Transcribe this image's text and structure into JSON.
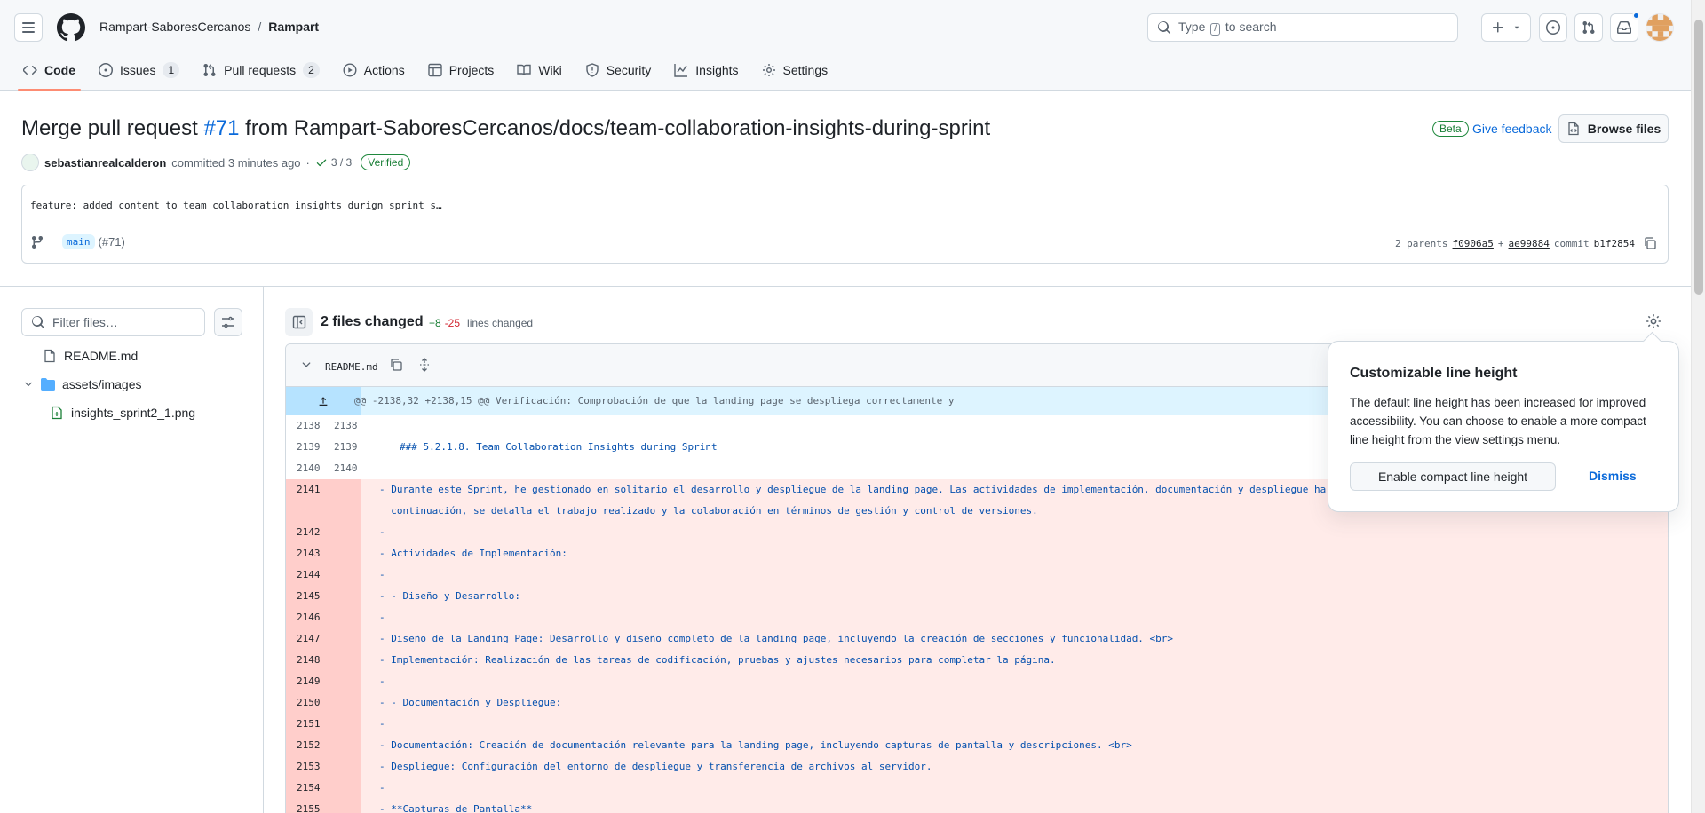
{
  "header": {
    "owner": "Rampart-SaboresCercanos",
    "separator": "/",
    "repo": "Rampart",
    "search_prefix": "Type",
    "search_key": "/",
    "search_suffix": "to search"
  },
  "repo_nav": [
    {
      "label": "Code",
      "icon": "code-icon",
      "selected": true
    },
    {
      "label": "Issues",
      "icon": "issue-icon",
      "count": "1"
    },
    {
      "label": "Pull requests",
      "icon": "pull-request-icon",
      "count": "2"
    },
    {
      "label": "Actions",
      "icon": "play-icon"
    },
    {
      "label": "Projects",
      "icon": "table-icon"
    },
    {
      "label": "Wiki",
      "icon": "book-icon"
    },
    {
      "label": "Security",
      "icon": "shield-icon"
    },
    {
      "label": "Insights",
      "icon": "graph-icon"
    },
    {
      "label": "Settings",
      "icon": "gear-icon"
    }
  ],
  "commit": {
    "title_prefix": "Merge pull request",
    "pr_number": "#71",
    "title_suffix": "from Rampart-SaboresCercanos/docs/team-collaboration-insights-during-sprint",
    "beta_label": "Beta",
    "feedback_label": "Give feedback",
    "browse_label": "Browse files",
    "author": "sebastianrealcalderon",
    "committed_text": "committed 3 minutes ago",
    "dot": "·",
    "checks": "3 / 3",
    "verified": "Verified",
    "message": "feature: added content to team collaboration insights durign sprint s…",
    "branch": "main",
    "branch_pr": "(#71)",
    "parents_label": "2 parents",
    "parent1": "f0906a5",
    "plus": "+",
    "parent2": "ae99884",
    "commit_label": "commit",
    "commit_sha": "b1f2854"
  },
  "sidebar": {
    "filter_placeholder": "Filter files…",
    "files": [
      {
        "name": "README.md",
        "type": "file"
      },
      {
        "name": "assets/images",
        "type": "folder"
      },
      {
        "name": "insights_sprint2_1.png",
        "type": "added-file"
      }
    ]
  },
  "diff": {
    "files_changed": "2 files changed",
    "additions": "+8",
    "deletions": "-25",
    "lines_changed": "lines changed",
    "file_name": "README.md",
    "hunk": "@@ -2138,32 +2138,15 @@ Verificación: Comprobación de que la landing page se despliega correctamente y",
    "rows": [
      {
        "kind": "ctx",
        "old": "2138",
        "new": "2138",
        "text": ""
      },
      {
        "kind": "ctx",
        "old": "2139",
        "new": "2139",
        "text": "### 5.2.1.8. Team Collaboration Insights during Sprint"
      },
      {
        "kind": "ctx",
        "old": "2140",
        "new": "2140",
        "text": ""
      },
      {
        "kind": "del-tall",
        "old": "2141",
        "new": "",
        "text": "- Durante este Sprint, he gestionado en solitario el desarrollo y despliegue de la landing page. Las actividades de implementación, documentación y despliegue ha",
        "text2": "  continuación, se detalla el trabajo realizado y la colaboración en términos de gestión y control de versiones."
      },
      {
        "kind": "del",
        "old": "2142",
        "new": "",
        "text": "-"
      },
      {
        "kind": "del",
        "old": "2143",
        "new": "",
        "text": "- Actividades de Implementación:"
      },
      {
        "kind": "del",
        "old": "2144",
        "new": "",
        "text": "-"
      },
      {
        "kind": "del",
        "old": "2145",
        "new": "",
        "text": "- - Diseño y Desarrollo:"
      },
      {
        "kind": "del",
        "old": "2146",
        "new": "",
        "text": "-"
      },
      {
        "kind": "del",
        "old": "2147",
        "new": "",
        "text": "- Diseño de la Landing Page: Desarrollo y diseño completo de la landing page, incluyendo la creación de secciones y funcionalidad. <br>"
      },
      {
        "kind": "del",
        "old": "2148",
        "new": "",
        "text": "- Implementación: Realización de las tareas de codificación, pruebas y ajustes necesarios para completar la página."
      },
      {
        "kind": "del",
        "old": "2149",
        "new": "",
        "text": "-"
      },
      {
        "kind": "del",
        "old": "2150",
        "new": "",
        "text": "- - Documentación y Despliegue:"
      },
      {
        "kind": "del",
        "old": "2151",
        "new": "",
        "text": "-"
      },
      {
        "kind": "del",
        "old": "2152",
        "new": "",
        "text": "- Documentación: Creación de documentación relevante para la landing page, incluyendo capturas de pantalla y descripciones. <br>"
      },
      {
        "kind": "del",
        "old": "2153",
        "new": "",
        "text": "- Despliegue: Configuración del entorno de despliegue y transferencia de archivos al servidor."
      },
      {
        "kind": "del",
        "old": "2154",
        "new": "",
        "text": "-"
      },
      {
        "kind": "del",
        "old": "2155",
        "new": "",
        "text": "- **Capturas de Pantalla**"
      }
    ]
  },
  "popover": {
    "title": "Customizable line height",
    "body": "The default line height has been increased for improved accessibility. You can choose to enable a more compact line height from the view settings menu.",
    "primary": "Enable compact line height",
    "dismiss": "Dismiss"
  },
  "colors": {
    "accent": "#0969da",
    "deleted_bg": "#ffebe9",
    "deleted_num_bg": "#ffcecb",
    "hunk_bg": "#ddf4ff",
    "nav_underline": "#fd8c73",
    "success": "#1a7f37"
  }
}
